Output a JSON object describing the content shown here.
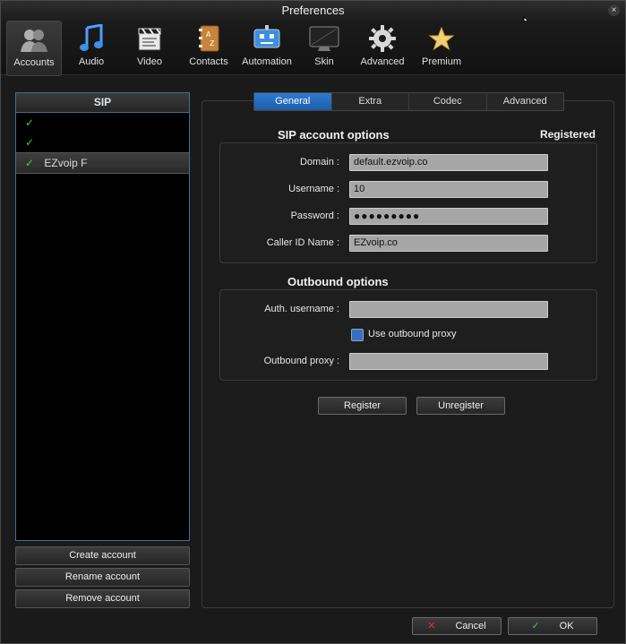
{
  "window": {
    "title": "Preferences",
    "close": "×"
  },
  "toolbar": [
    {
      "label": "Accounts",
      "icon": "accounts-icon"
    },
    {
      "label": "Audio",
      "icon": "music-note-icon"
    },
    {
      "label": "Video",
      "icon": "clapperboard-icon"
    },
    {
      "label": "Contacts",
      "icon": "address-book-icon"
    },
    {
      "label": "Automation",
      "icon": "robot-icon"
    },
    {
      "label": "Skin",
      "icon": "monitor-icon"
    },
    {
      "label": "Advanced",
      "icon": "gear-icon"
    },
    {
      "label": "Premium",
      "icon": "star-icon"
    }
  ],
  "accounts_panel": {
    "header": "SIP",
    "items": [
      {
        "check": "✓",
        "name": ""
      },
      {
        "check": "✓",
        "name": ""
      },
      {
        "check": "✓",
        "name": "EZvoip F"
      }
    ],
    "buttons": {
      "create": "Create account",
      "rename": "Rename account",
      "remove": "Remove account"
    }
  },
  "tabs": [
    "General",
    "Extra",
    "Codec",
    "Advanced"
  ],
  "sip_options": {
    "title": "SIP account options",
    "status": "Registered",
    "domain_label": "Domain :",
    "domain_value": "default.ezvoip.co",
    "username_label": "Username :",
    "username_value": "10",
    "password_label": "Password :",
    "password_value": "●●●●●●●●●",
    "callerid_label": "Caller ID Name :",
    "callerid_value": "EZvoip.co"
  },
  "outbound": {
    "title": "Outbound options",
    "auth_label": "Auth. username :",
    "auth_value": "",
    "proxy_checkbox_label": "Use outbound proxy",
    "proxy_label": "Outbound proxy :",
    "proxy_value": ""
  },
  "actions": {
    "register": "Register",
    "unregister": "Unregister"
  },
  "footer": {
    "cancel": "Cancel",
    "cancel_icon": "✕",
    "ok": "OK",
    "ok_icon": "✓"
  },
  "colors": {
    "accent_blue": "#2d7ad0",
    "check_green": "#32d232",
    "cancel_red": "#e03030"
  }
}
